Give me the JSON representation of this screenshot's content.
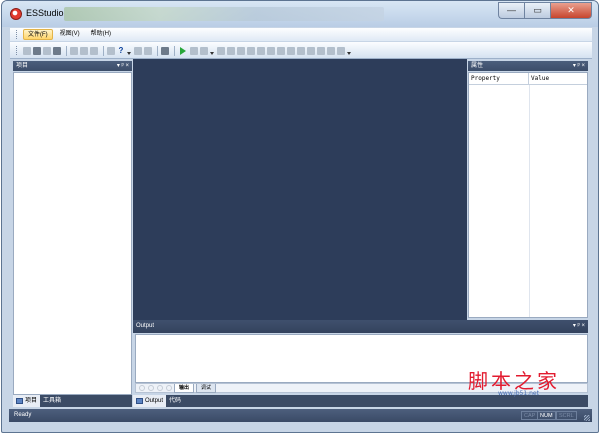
{
  "window": {
    "title": "ESStudio",
    "minimize": "—",
    "maximize": "▭",
    "close": "✕"
  },
  "menu": {
    "items": [
      "文件(F)",
      "视图(V)",
      "帮助(H)"
    ]
  },
  "project_pane": {
    "title": "项目",
    "pin": "▾ ᵖ ×",
    "tabs": [
      "项目",
      "工具箱"
    ]
  },
  "properties_pane": {
    "title": "属性",
    "pin": "▾ ᵖ ×",
    "columns": [
      "Property",
      "Value"
    ]
  },
  "output_pane": {
    "title": "Output",
    "pin": "▾ ᵖ ×",
    "subtabs": [
      "输出",
      "调试"
    ],
    "tabs": [
      "Output",
      "代码"
    ]
  },
  "statusbar": {
    "text": "Ready",
    "indicators": [
      "CAP",
      "NUM",
      "SCRL"
    ]
  },
  "watermark": {
    "main": "脚本之家",
    "sub": "www.jb51.net"
  },
  "colors": {
    "workspace": "#2d3d5a",
    "pane_header": "#3c4d69",
    "accent_close": "#c7452d"
  }
}
